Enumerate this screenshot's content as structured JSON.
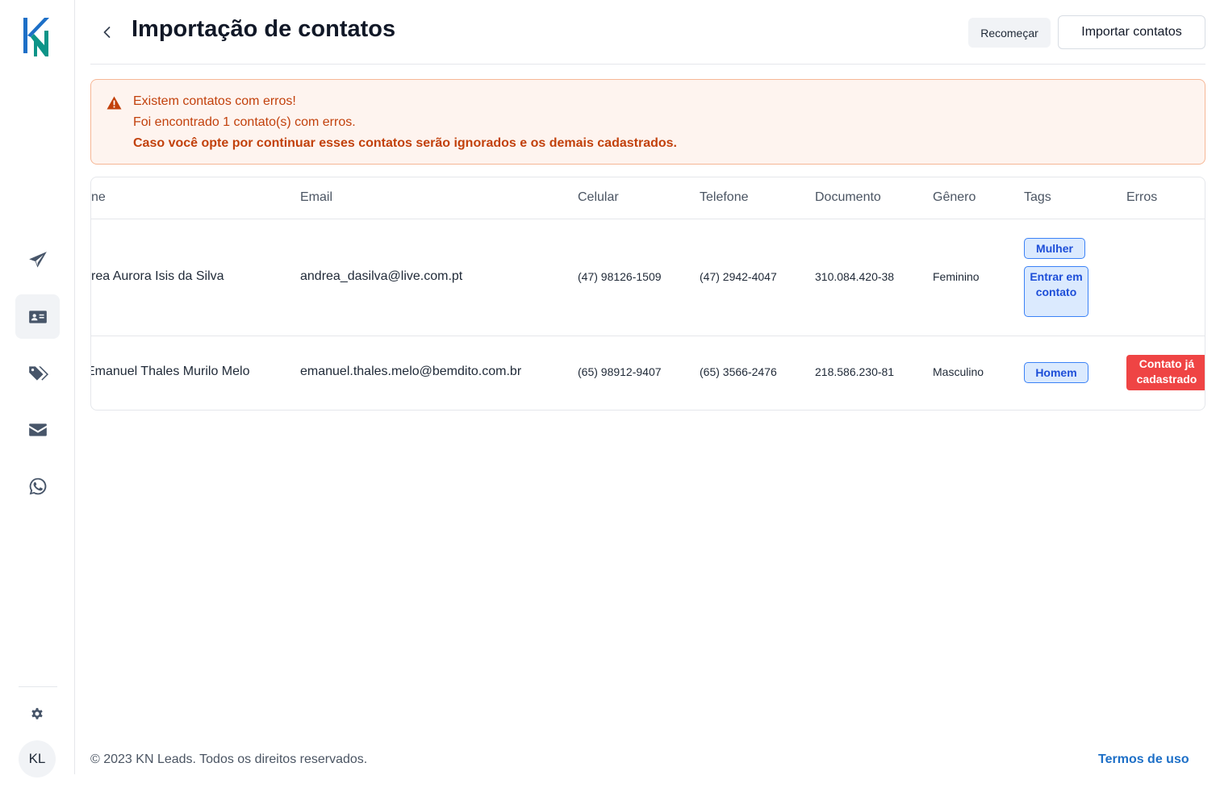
{
  "brand": {
    "logo_text": "KN",
    "logo_colors": [
      "#1d6fc7",
      "#0d9488"
    ]
  },
  "sidebar": {
    "items": [
      {
        "name": "campaigns",
        "icon": "paper-plane-icon",
        "active": false
      },
      {
        "name": "contacts",
        "icon": "contact-card-icon",
        "active": true
      },
      {
        "name": "tags",
        "icon": "tags-icon",
        "active": false
      },
      {
        "name": "email",
        "icon": "envelope-icon",
        "active": false
      },
      {
        "name": "whatsapp",
        "icon": "whatsapp-icon",
        "active": false
      }
    ],
    "settings_icon": "gear-icon",
    "avatar_initials": "KL"
  },
  "header": {
    "title": "Importação de contatos",
    "restart_label": "Recomeçar",
    "import_label": "Importar contatos"
  },
  "alert": {
    "title": "Existem contatos com erros!",
    "line1": "Foi encontrado 1 contato(s) com erros.",
    "line2": "Caso você opte por continuar esses contatos serão ignorados e os demais cadastrados.",
    "color": "#c2410c"
  },
  "table": {
    "columns": [
      "ne",
      "Email",
      "Celular",
      "Telefone",
      "Documento",
      "Gênero",
      "Tags",
      "Erros"
    ],
    "rows": [
      {
        "name": "rea Aurora Isis da Silva",
        "email": "andrea_dasilva@live.com.pt",
        "mobile": "(47) 98126-1509",
        "phone": "(47) 2942-4047",
        "document": "310.084.420-38",
        "gender": "Feminino",
        "tags": [
          "Mulher",
          "Entrar em contato"
        ],
        "error": ""
      },
      {
        "name": "Emanuel Thales Murilo Melo",
        "email": "emanuel.thales.melo@bemdito.com.br",
        "mobile": "(65) 98912-9407",
        "phone": "(65) 3566-2476",
        "document": "218.586.230-81",
        "gender": "Masculino",
        "tags": [
          "Homem"
        ],
        "error": "Contato já cadastrado"
      }
    ]
  },
  "footer": {
    "copyright": "© 2023 KN Leads. Todos os direitos reservados.",
    "terms_label": "Termos de uso"
  }
}
